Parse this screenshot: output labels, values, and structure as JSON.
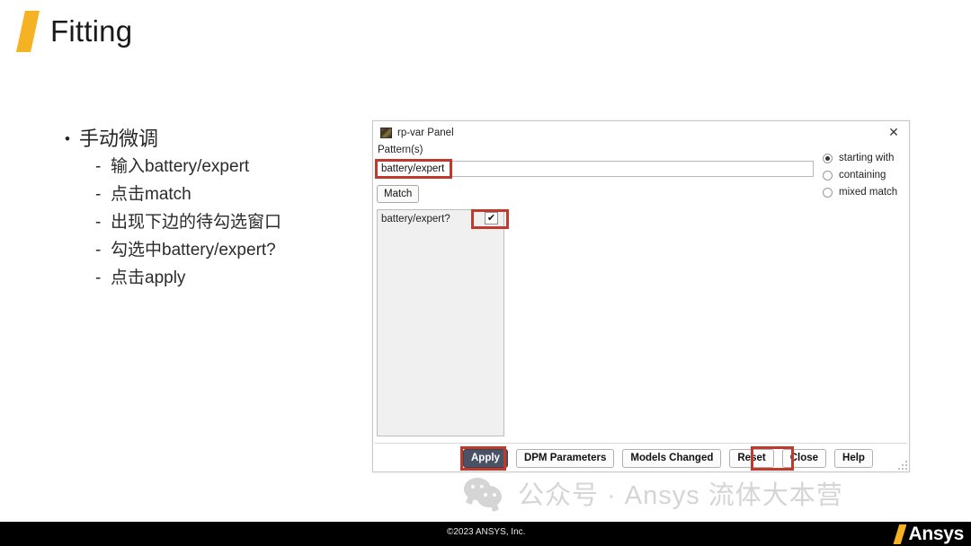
{
  "slide": {
    "title": "Fitting",
    "bullets": {
      "main": "手动微调",
      "sub": [
        "输入battery/expert",
        "点击match",
        "出现下边的待勾选窗口",
        "勾选中battery/expert?",
        "点击apply"
      ]
    }
  },
  "dialog": {
    "title": "rp-var Panel",
    "close_label": "✕",
    "pattern_label": "Pattern(s)",
    "pattern_value": "battery/expert",
    "pattern_placeholder": "",
    "match_button": "Match",
    "match_modes": [
      {
        "label": "starting with",
        "selected": true
      },
      {
        "label": "containing",
        "selected": false
      },
      {
        "label": "mixed match",
        "selected": false
      }
    ],
    "list_items": [
      {
        "label": "battery/expert?",
        "checked": true,
        "check_glyph": "✔"
      }
    ],
    "buttons": [
      {
        "label": "Apply",
        "primary": true
      },
      {
        "label": "DPM Parameters",
        "primary": false
      },
      {
        "label": "Models Changed",
        "primary": false
      },
      {
        "label": "Reset",
        "primary": false
      },
      {
        "label": "Close",
        "primary": false
      },
      {
        "label": "Help",
        "primary": false
      }
    ]
  },
  "watermark": {
    "icon": "wechat-icon",
    "text": "公众号 · Ansys 流体大本营"
  },
  "footer": {
    "copyright": "©2023 ANSYS,  Inc.",
    "brand": "Ansys"
  },
  "colors": {
    "accent_yellow": "#f5b323",
    "annotation_red": "#c0392b",
    "primary_button": "#4a5366",
    "footer_bar": "#000000"
  }
}
